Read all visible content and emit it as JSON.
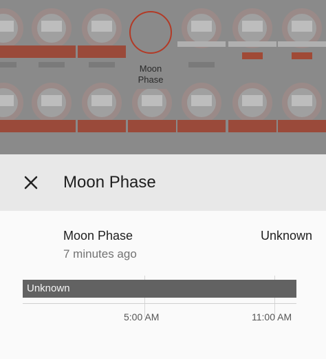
{
  "background": {
    "tile_label": "Moon\nPhase",
    "tile_label_line1": "Moon",
    "tile_label_line2": "Phase"
  },
  "dialog": {
    "title": "Moon Phase",
    "close_icon": "close-icon"
  },
  "entity": {
    "name": "Moon Phase",
    "state": "Unknown",
    "last_changed": "7 minutes ago"
  },
  "timeline": {
    "segments": [
      {
        "label": "Unknown",
        "color": "#626262"
      }
    ],
    "ticks": [
      "5:00 AM",
      "11:00 AM"
    ]
  },
  "colors": {
    "accent": "#b23a26",
    "header_bg": "#e8e8e8",
    "timeline_bar": "#626262"
  }
}
